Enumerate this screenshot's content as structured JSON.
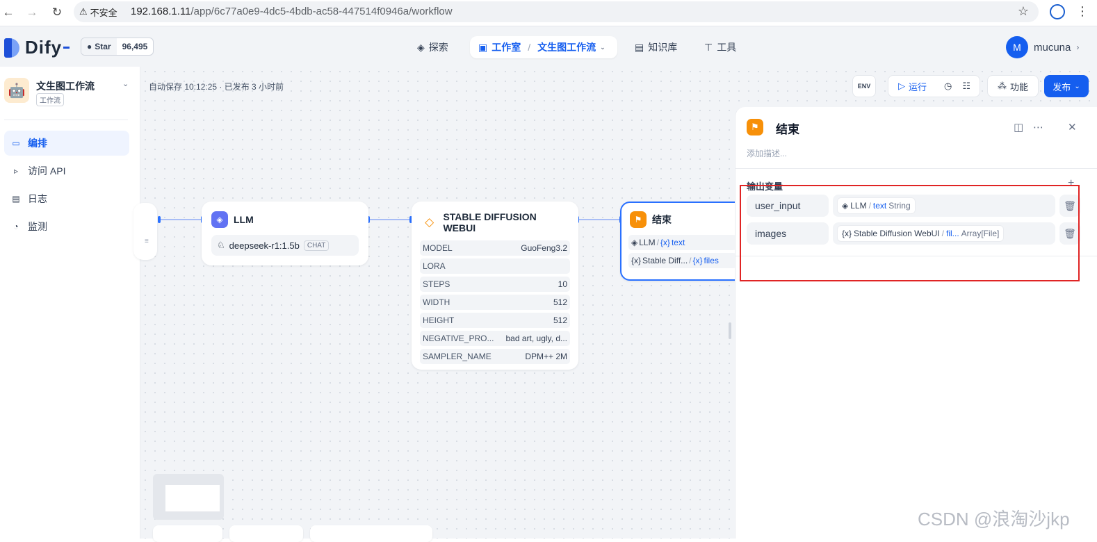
{
  "browser": {
    "security_label": "不安全",
    "url_host": "192.168.1.11",
    "url_path": "/app/6c77a0e9-4dc5-4bdb-ac58-447514f0946a/workflow"
  },
  "header": {
    "brand": "Dify",
    "github_star_label": "Star",
    "github_star_count": "96,495",
    "nav": {
      "explore": "探索",
      "studio": "工作室",
      "current_app": "文生图工作流",
      "knowledge": "知识库",
      "tools": "工具"
    },
    "user": {
      "initial": "M",
      "name": "mucuna"
    }
  },
  "sidebar": {
    "app_name": "文生图工作流",
    "app_type": "工作流",
    "items": [
      {
        "label": "编排",
        "icon": "layout-icon",
        "active": true
      },
      {
        "label": "访问 API",
        "icon": "terminal-icon",
        "active": false
      },
      {
        "label": "日志",
        "icon": "file-icon",
        "active": false
      },
      {
        "label": "监测",
        "icon": "gauge-icon",
        "active": false
      }
    ]
  },
  "toolbar": {
    "save_status": "自动保存 10:12:25 · 已发布 3 小时前",
    "env_label": "ENV",
    "run_label": "运行",
    "features_label": "功能",
    "publish_label": "发布"
  },
  "nodes": {
    "llm": {
      "title": "LLM",
      "model": "deepseek-r1:1.5b",
      "model_tag": "CHAT"
    },
    "sd": {
      "title": "STABLE DIFFUSION WEBUI",
      "params": [
        {
          "key": "MODEL",
          "value": "GuoFeng3.2"
        },
        {
          "key": "LORA",
          "value": ""
        },
        {
          "key": "STEPS",
          "value": "10"
        },
        {
          "key": "WIDTH",
          "value": "512"
        },
        {
          "key": "HEIGHT",
          "value": "512"
        },
        {
          "key": "NEGATIVE_PRO...",
          "value": "bad art, ugly, d..."
        },
        {
          "key": "SAMPLER_NAME",
          "value": "DPM++ 2M"
        }
      ]
    },
    "end": {
      "title": "结束",
      "vars": [
        {
          "source": "LLM",
          "var": "text"
        },
        {
          "source": "Stable Diff...",
          "var": "files"
        }
      ]
    }
  },
  "panel": {
    "title": "结束",
    "description_placeholder": "添加描述...",
    "output_label": "输出变量",
    "outputs": [
      {
        "name": "user_input",
        "source": "LLM",
        "var": "text",
        "type": "String"
      },
      {
        "name": "images",
        "source": "Stable Diffusion WebUI",
        "var": "fil...",
        "type": "Array[File]"
      }
    ]
  },
  "watermark": "CSDN @浪淘沙jkp"
}
